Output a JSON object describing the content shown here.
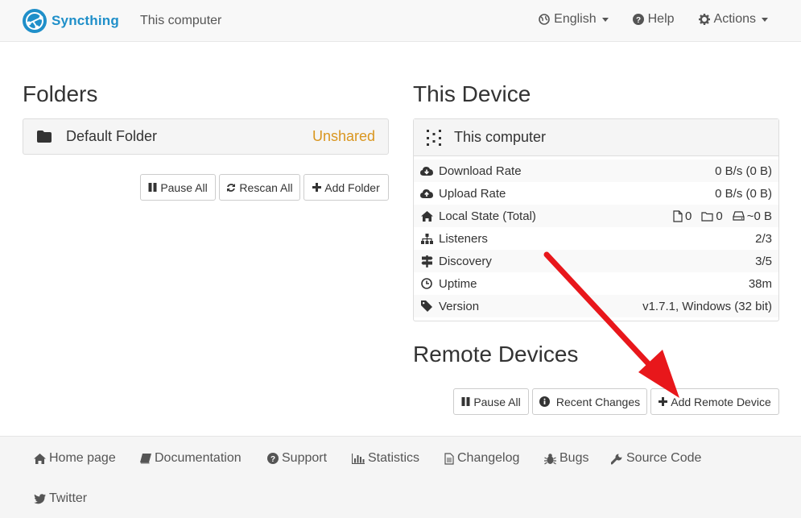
{
  "navbar": {
    "brand": "Syncthing",
    "device_name": "This computer",
    "language": "English",
    "help": "Help",
    "actions": "Actions"
  },
  "folders": {
    "heading": "Folders",
    "items": [
      {
        "label": "Default Folder",
        "status": "Unshared"
      }
    ],
    "buttons": {
      "pause_all": "Pause All",
      "rescan_all": "Rescan All",
      "add_folder": "Add Folder"
    }
  },
  "this_device": {
    "heading": "This Device",
    "name": "This computer",
    "stats": [
      {
        "icon": "cloud-download-icon",
        "label": "Download Rate",
        "value": "0 B/s (0 B)"
      },
      {
        "icon": "cloud-upload-icon",
        "label": "Upload Rate",
        "value": "0 B/s (0 B)"
      },
      {
        "icon": "home-icon",
        "label": "Local State (Total)",
        "files": "0",
        "dirs": "0",
        "size": "~0 B"
      },
      {
        "icon": "sitemap-icon",
        "label": "Listeners",
        "value": "2/3"
      },
      {
        "icon": "signpost-icon",
        "label": "Discovery",
        "value": "3/5"
      },
      {
        "icon": "clock-icon",
        "label": "Uptime",
        "value": "38m"
      },
      {
        "icon": "tag-icon",
        "label": "Version",
        "value": "v1.7.1, Windows (32 bit)"
      }
    ]
  },
  "remote_devices": {
    "heading": "Remote Devices",
    "buttons": {
      "pause_all": "Pause All",
      "recent_changes": "Recent Changes",
      "add_remote_device": "Add Remote Device"
    }
  },
  "footer": {
    "links": {
      "home_page": "Home page",
      "documentation": "Documentation",
      "support": "Support",
      "statistics": "Statistics",
      "changelog": "Changelog",
      "bugs": "Bugs",
      "source_code": "Source Code",
      "twitter": "Twitter"
    }
  },
  "colors": {
    "brand": "#1f8fc9",
    "unshared": "#d9961f",
    "arrow": "#e8171b"
  },
  "annotation": {
    "arrow_icon": "red-arrow-icon"
  }
}
